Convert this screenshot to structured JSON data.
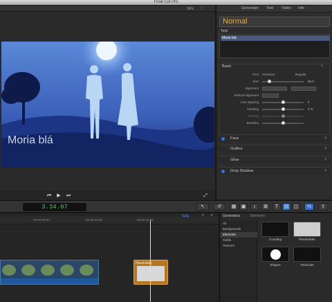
{
  "window": {
    "title": "Final Cut Pro"
  },
  "viewer": {
    "zoom": "36%",
    "caption": "Moria blá"
  },
  "inspector": {
    "tabs": [
      "Generator",
      "Text",
      "Video",
      "Info"
    ],
    "preset": "Normal",
    "text_section": "Text",
    "text_value": "Moria blá",
    "basic_section": "Basic",
    "params": [
      {
        "label": "Font",
        "value": "Helvetica"
      },
      {
        "label": "Size",
        "value": "86.0"
      },
      {
        "label": "Alignment",
        "value": ""
      },
      {
        "label": "Vertical Alignment",
        "value": ""
      },
      {
        "label": "Line Spacing",
        "value": "0"
      },
      {
        "label": "Tracking",
        "value": "0 %"
      },
      {
        "label": "Kerning",
        "value": "0"
      },
      {
        "label": "Baseline",
        "value": "0"
      }
    ],
    "font_style": "Regular",
    "effects": [
      "Face",
      "Outline",
      "Glow",
      "Drop Shadow"
    ]
  },
  "toolbar": {
    "timecode": "3.34.07"
  },
  "timeline": {
    "ruler": [
      "00:00:00:00",
      "00:00:10:00",
      "00:00:20:00"
    ],
    "clip_label": "Placeholder"
  },
  "browser": {
    "tabs": [
      "Generators",
      "Elements"
    ],
    "categories": [
      "All",
      "Backgrounds",
      "Elements",
      "Solids",
      "Textures"
    ],
    "items": [
      "Counting",
      "Placeholder",
      "Shapes",
      "Timecode"
    ]
  }
}
